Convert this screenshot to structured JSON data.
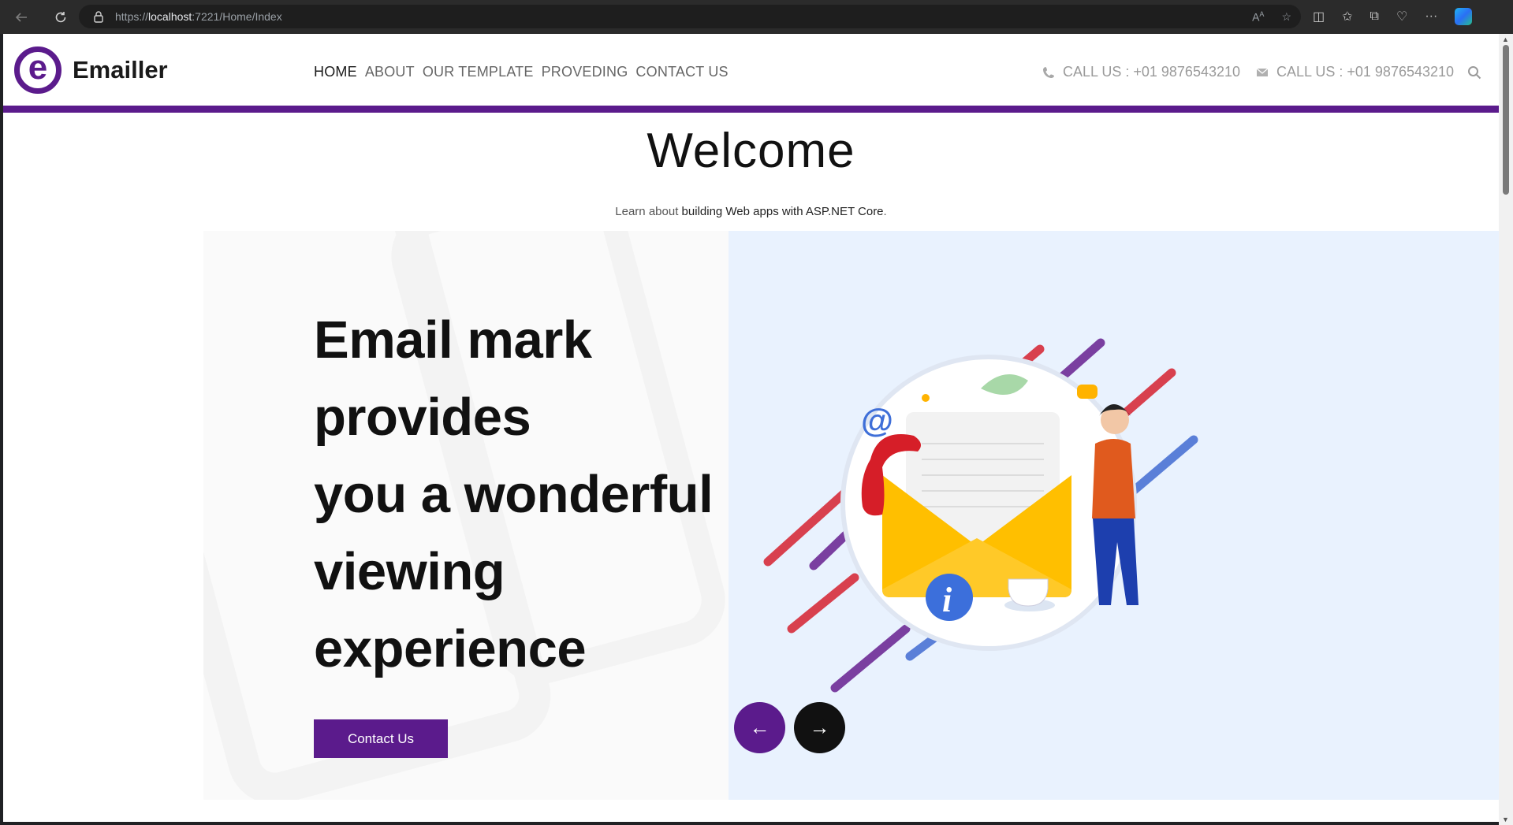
{
  "browser": {
    "url_prefix": "https://",
    "url_host": "localhost",
    "url_path": ":7221/Home/Index"
  },
  "site": {
    "brand_letter": "e",
    "brand_name": "Emailler",
    "nav": [
      {
        "label": "HOME",
        "active": true
      },
      {
        "label": "ABOUT"
      },
      {
        "label": "OUR TEMPLATE"
      },
      {
        "label": "PROVEDING"
      },
      {
        "label": "CONTACT US"
      }
    ],
    "contact": {
      "phone": "CALL US : +01 9876543210",
      "email": "CALL US : +01 9876543210"
    }
  },
  "welcome": {
    "title": "Welcome",
    "learn_prefix": "Learn ",
    "learn_about": "about",
    "learn_link": "building Web apps with ASP.NET Core",
    "learn_suffix": "."
  },
  "hero": {
    "lines": [
      "Email mark",
      "provides",
      "you a wonderful",
      "viewing",
      "experience"
    ],
    "cta_label": "Contact Us",
    "prev_label": "←",
    "next_label": "→"
  },
  "colors": {
    "brand": "#5b1b8c",
    "hero_bg": "#e9f2fe"
  },
  "icons": [
    "back-arrow-icon",
    "refresh-icon",
    "lock-icon",
    "read-aloud-icon",
    "star-icon",
    "split-screen-icon",
    "favorites-icon",
    "collections-icon",
    "browser-essentials-icon",
    "more-icon",
    "copilot-icon",
    "phone-icon",
    "mail-icon",
    "search-icon"
  ]
}
